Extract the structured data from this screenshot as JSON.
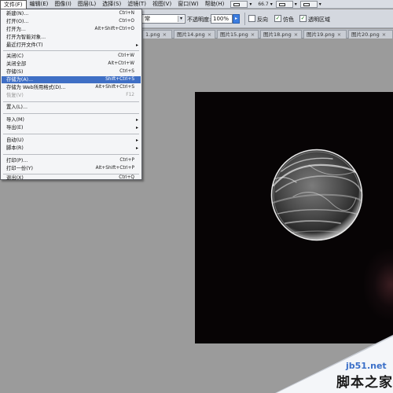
{
  "menubar": {
    "items": [
      "文件(F)",
      "编辑(E)",
      "图像(I)",
      "图层(L)",
      "选择(S)",
      "滤镜(T)",
      "视图(V)",
      "窗口(W)",
      "帮助(H)"
    ],
    "zoom": "66.7"
  },
  "options": {
    "mode_value": "常",
    "opacity_label": "不透明度:",
    "opacity_value": "100%",
    "reverse_label": "反向",
    "dither_label": "仿色",
    "transparency_label": "透明区域"
  },
  "tabs": [
    "1.png",
    "图片14.png",
    "图片15.png",
    "图片18.png",
    "图片19.png",
    "图片20.png"
  ],
  "file_menu": {
    "new": {
      "label": "新建(N)...",
      "shortcut": "Ctrl+N"
    },
    "open": {
      "label": "打开(O)...",
      "shortcut": "Ctrl+O"
    },
    "open_as": {
      "label": "打开为...",
      "shortcut": "Alt+Shift+Ctrl+O"
    },
    "open_smart": {
      "label": "打开为智能对象..."
    },
    "recent": {
      "label": "最近打开文件(T)"
    },
    "close": {
      "label": "关闭(C)",
      "shortcut": "Ctrl+W"
    },
    "close_all": {
      "label": "关闭全部",
      "shortcut": "Alt+Ctrl+W"
    },
    "save": {
      "label": "存储(S)",
      "shortcut": "Ctrl+S"
    },
    "save_as": {
      "label": "存储为(A)...",
      "shortcut": "Shift+Ctrl+S"
    },
    "save_web": {
      "label": "存储为 Web所用格式(D)...",
      "shortcut": "Alt+Shift+Ctrl+S"
    },
    "revert": {
      "label": "恢复(V)",
      "shortcut": "F12"
    },
    "place": {
      "label": "置入(L)..."
    },
    "import": {
      "label": "导入(M)"
    },
    "export": {
      "label": "导出(E)"
    },
    "automate": {
      "label": "自动(U)"
    },
    "scripts": {
      "label": "脚本(R)"
    },
    "print": {
      "label": "打印(P)...",
      "shortcut": "Ctrl+P"
    },
    "print_one": {
      "label": "打印一份(Y)",
      "shortcut": "Alt+Shift+Ctrl+P"
    },
    "exit": {
      "label": "退出(X)",
      "shortcut": "Ctrl+Q"
    }
  },
  "watermark": {
    "url": "jb51.net",
    "name": "脚本之家"
  }
}
